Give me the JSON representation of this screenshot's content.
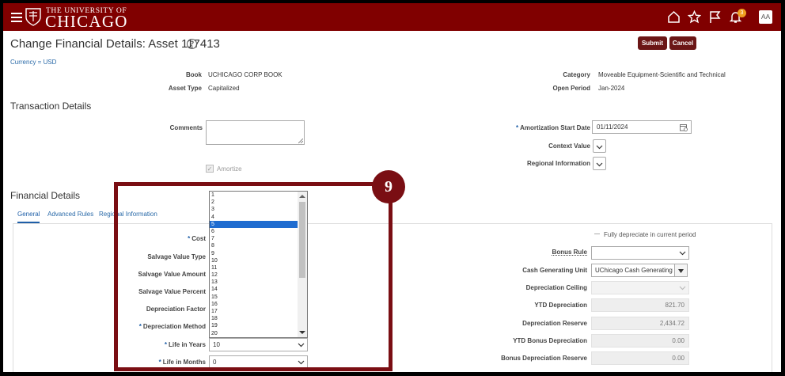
{
  "header": {
    "logo_line1": "THE UNIVERSITY OF",
    "logo_line2": "CHICAGO",
    "notification_count": "3",
    "user_initials": "AA",
    "brand_color": "#800000"
  },
  "page": {
    "title": "Change Financial Details: Asset 117413",
    "help_symbol": "?",
    "submit_label": "Submit",
    "cancel_label": "Cancel",
    "breadcrumb": "Currency = USD"
  },
  "summary": {
    "book_label": "Book",
    "book_value": "UCHICAGO CORP BOOK",
    "asset_type_label": "Asset Type",
    "asset_type_value": "Capitalized",
    "category_label": "Category",
    "category_value": "Moveable Equipment-Scientific and Technical",
    "open_period_label": "Open Period",
    "open_period_value": "Jan-2024"
  },
  "transaction": {
    "heading": "Transaction Details",
    "comments_label": "Comments",
    "amortize_label": "Amortize",
    "amortize_checked": true,
    "amortization_start_label": "Amortization Start Date",
    "amortization_start_value": "01/11/2024",
    "context_value_label": "Context Value",
    "regional_info_label": "Regional Information"
  },
  "financial": {
    "heading": "Financial Details",
    "tabs": [
      "General",
      "Advanced Rules",
      "Regional Information"
    ],
    "active_tab": "General",
    "left_labels": {
      "cost": "Cost",
      "salvage_value_type": "Salvage Value Type",
      "salvage_value_amount": "Salvage Value Amount",
      "salvage_value_percent": "Salvage Value Percent",
      "depreciation_factor": "Depreciation Factor",
      "depreciation_method": "Depreciation Method",
      "life_in_years": "Life in Years",
      "life_in_months": "Life in Months"
    },
    "life_in_years_value": "10",
    "life_in_months_value": "0",
    "fully_depreciate_label": "Fully depreciate in current period",
    "right_fields": {
      "bonus_rule_label": "Bonus Rule",
      "cash_generating_unit_label": "Cash Generating Unit",
      "cash_generating_unit_value": "UChicago Cash Generating U",
      "depreciation_ceiling_label": "Depreciation Ceiling",
      "ytd_depreciation_label": "YTD Depreciation",
      "ytd_depreciation_value": "821.70",
      "depreciation_reserve_label": "Depreciation Reserve",
      "depreciation_reserve_value": "2,434.72",
      "ytd_bonus_depreciation_label": "YTD Bonus Depreciation",
      "ytd_bonus_depreciation_value": "0.00",
      "bonus_depreciation_reserve_label": "Bonus Depreciation Reserve",
      "bonus_depreciation_reserve_value": "0.00"
    }
  },
  "dropdown_list": {
    "options": [
      "1",
      "2",
      "3",
      "4",
      "5",
      "6",
      "7",
      "8",
      "9",
      "10",
      "11",
      "12",
      "13",
      "14",
      "15",
      "16",
      "17",
      "18",
      "19",
      "20"
    ],
    "selected": "5"
  },
  "callout": {
    "step_number": "9",
    "color": "#7a0e13"
  }
}
